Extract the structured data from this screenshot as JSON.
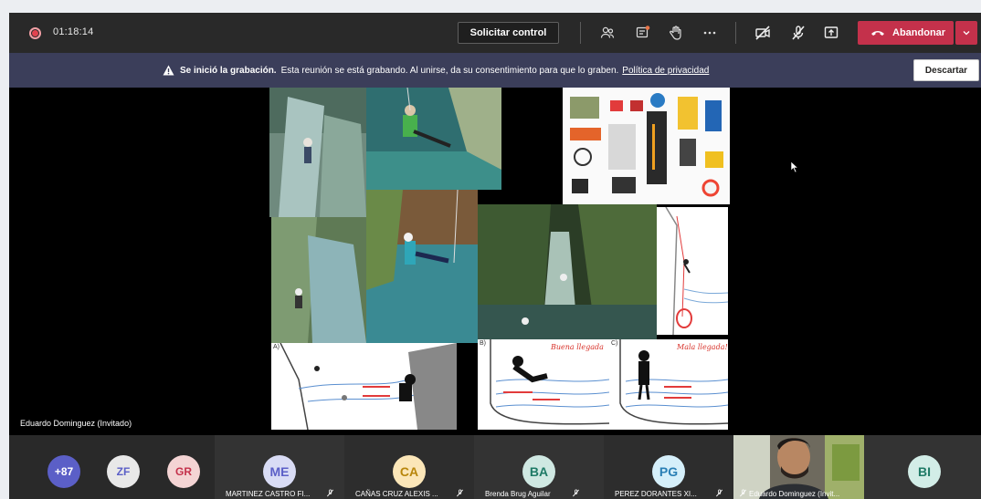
{
  "topbar": {
    "timer": "01:18:14",
    "request_control": "Solicitar control",
    "leave": "Abandonar",
    "icons": [
      "participants-icon",
      "chat-icon",
      "raise-hand-icon",
      "more-icon",
      "camera-off-icon",
      "mic-off-icon",
      "share-icon"
    ]
  },
  "banner": {
    "bold": "Se inició la grabación.",
    "text": "Esta reunión se está grabando. Al unirse, da su consentimiento para que lo graben.",
    "link": "Política de privacidad",
    "dismiss": "Descartar"
  },
  "stage": {
    "presenter": "Eduardo Dominguez (Invitado)",
    "slide_labels": {
      "good": "Buena llegada",
      "bad": "Mala llegada!",
      "a": "A)",
      "b": "B)",
      "c": "C)"
    }
  },
  "participants": {
    "overflow": "+87",
    "small": [
      {
        "initials": "ZF",
        "color": "#e8e8e8",
        "text_color": "#5b5fc7"
      },
      {
        "initials": "GR",
        "color": "#f4d4d4",
        "text_color": "#c4314b"
      }
    ],
    "tiles": [
      {
        "initials": "ME",
        "name": "MARTINEZ CASTRO FI...",
        "bg": "#d9dcf5",
        "fg": "#5b5fc7"
      },
      {
        "initials": "CA",
        "name": "CAÑAS CRUZ ALEXIS ...",
        "bg": "#fbe6b8",
        "fg": "#b8860b"
      },
      {
        "initials": "BA",
        "name": "Brenda Brug Aguilar",
        "bg": "#cfe8e2",
        "fg": "#1e7a66"
      },
      {
        "initials": "PG",
        "name": "PEREZ DORANTES XI...",
        "bg": "#d5effa",
        "fg": "#2a7fb5"
      },
      {
        "initials": "",
        "name": "Eduardo Dominguez (Invit..."
      },
      {
        "initials": "BI",
        "name": "",
        "bg": "#d2ede7",
        "fg": "#1e7a66"
      }
    ]
  }
}
